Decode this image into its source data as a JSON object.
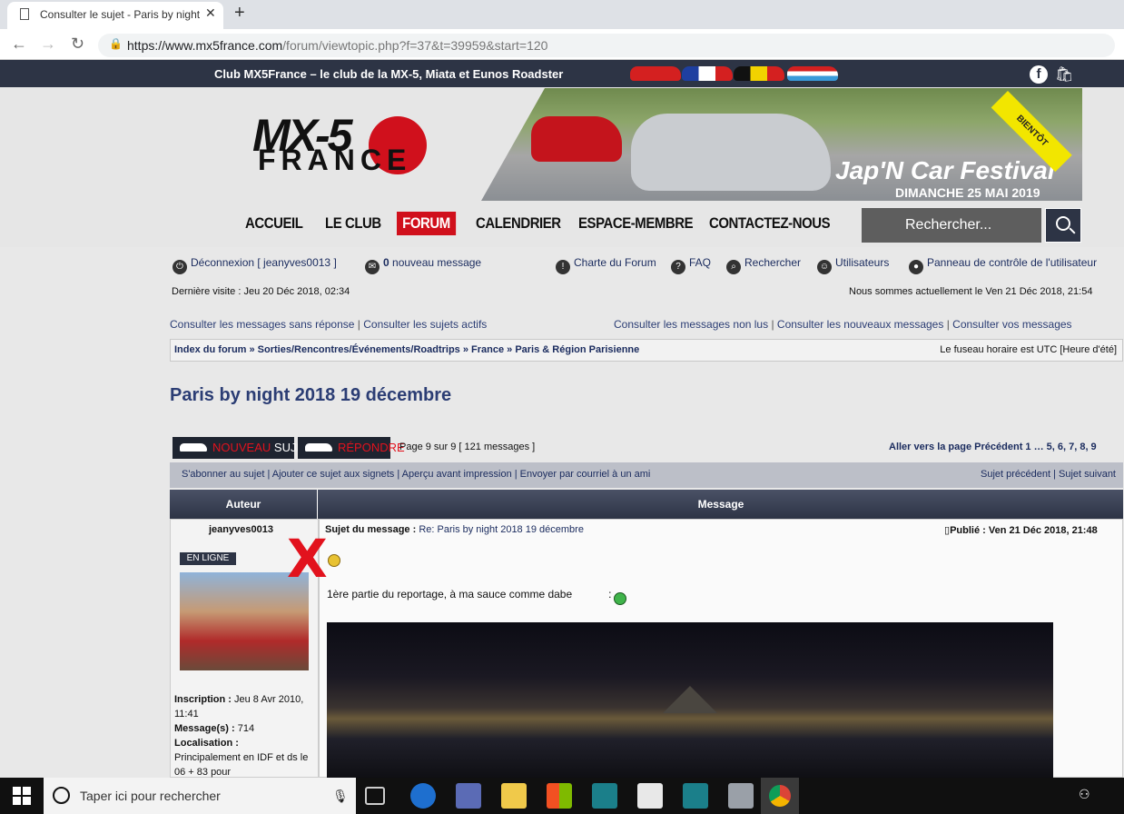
{
  "browser": {
    "tab_title": "Consulter le sujet - Paris by night",
    "tab_close": "✕",
    "new_tab": "+",
    "url_host": "https://www.mx5france.com",
    "url_path": "/forum/viewtopic.php?f=37&t=39959&start=120"
  },
  "site": {
    "club_text": "Club MX5France – le club de la MX-5, Miata et Eunos Roadster",
    "logo_mx": "MX-5",
    "logo_france": "FRANCE",
    "banner_title": "Jap'N Car Festival",
    "banner_date": "DIMANCHE 25 MAI 2019",
    "banner_badge": "BIENTÔT",
    "nav": [
      "ACCUEIL",
      "LE CLUB",
      "FORUM",
      "CALENDRIER",
      "ESPACE-MEMBRE",
      "CONTACTEZ-NOUS"
    ],
    "search_placeholder": "Rechercher..."
  },
  "forum": {
    "logout": "Déconnexion [ jeanyves0013 ]",
    "msg_count": "0",
    "msg_label": "nouveau message",
    "charte": "Charte du Forum",
    "faq": "FAQ",
    "rechercher": "Rechercher",
    "utilisateurs": "Utilisateurs",
    "panneau": "Panneau de contrôle de l'utilisateur",
    "last_visit": "Dernière visite : Jeu 20 Déc 2018, 02:34",
    "now": "Nous sommes actuellement le Ven 21 Déc 2018, 21:54",
    "q1": "Consulter les messages sans réponse",
    "q2": "Consulter les sujets actifs",
    "q3": "Consulter les messages non lus",
    "q4": "Consulter les nouveaux messages",
    "q5": "Consulter vos messages",
    "breadcrumb": "Index du forum » Sorties/Rencontres/Événements/Roadtrips » France » Paris & Région Parisienne",
    "timezone": "Le fuseau horaire est UTC [Heure d'été]",
    "topic_title": "Paris by night 2018 19 décembre",
    "btn_new_a": "NOUVEAU",
    "btn_new_b": " SUJET",
    "btn_reply": "RÉPONDRE",
    "page_info": "Page 9 sur 9   [ 121 messages ]",
    "goto": "Aller vers la page Précédent  1 … 5, 6, 7, 8, 9",
    "actions_left": "S'abonner au sujet | Ajouter ce sujet aux signets | Aperçu avant impression | Envoyer par courriel à un ami",
    "actions_right": "Sujet précédent | Sujet suivant",
    "col_author": "Auteur",
    "col_message": "Message"
  },
  "post": {
    "author": "jeanyves0013",
    "online": "EN LIGNE",
    "x_mark": "X",
    "subject_label": "Sujet du message :",
    "subject_value": "Re: Paris by night 2018 19 décembre",
    "published": "Publié : Ven 21 Déc 2018, 21:48",
    "body_text": "1ère partie du reportage, à ma sauce comme dabe",
    "body_colon": ":",
    "inscription_label": "Inscription :",
    "inscription_value": "Jeu 8 Avr 2010, 11:41",
    "messages_label": "Message(s) :",
    "messages_value": "714",
    "localisation_label": "Localisation :",
    "localisation_value": "Principalement en IDF et ds le 06 + 83 pour"
  },
  "taskbar": {
    "search_text": "Taper ici pour rechercher"
  }
}
